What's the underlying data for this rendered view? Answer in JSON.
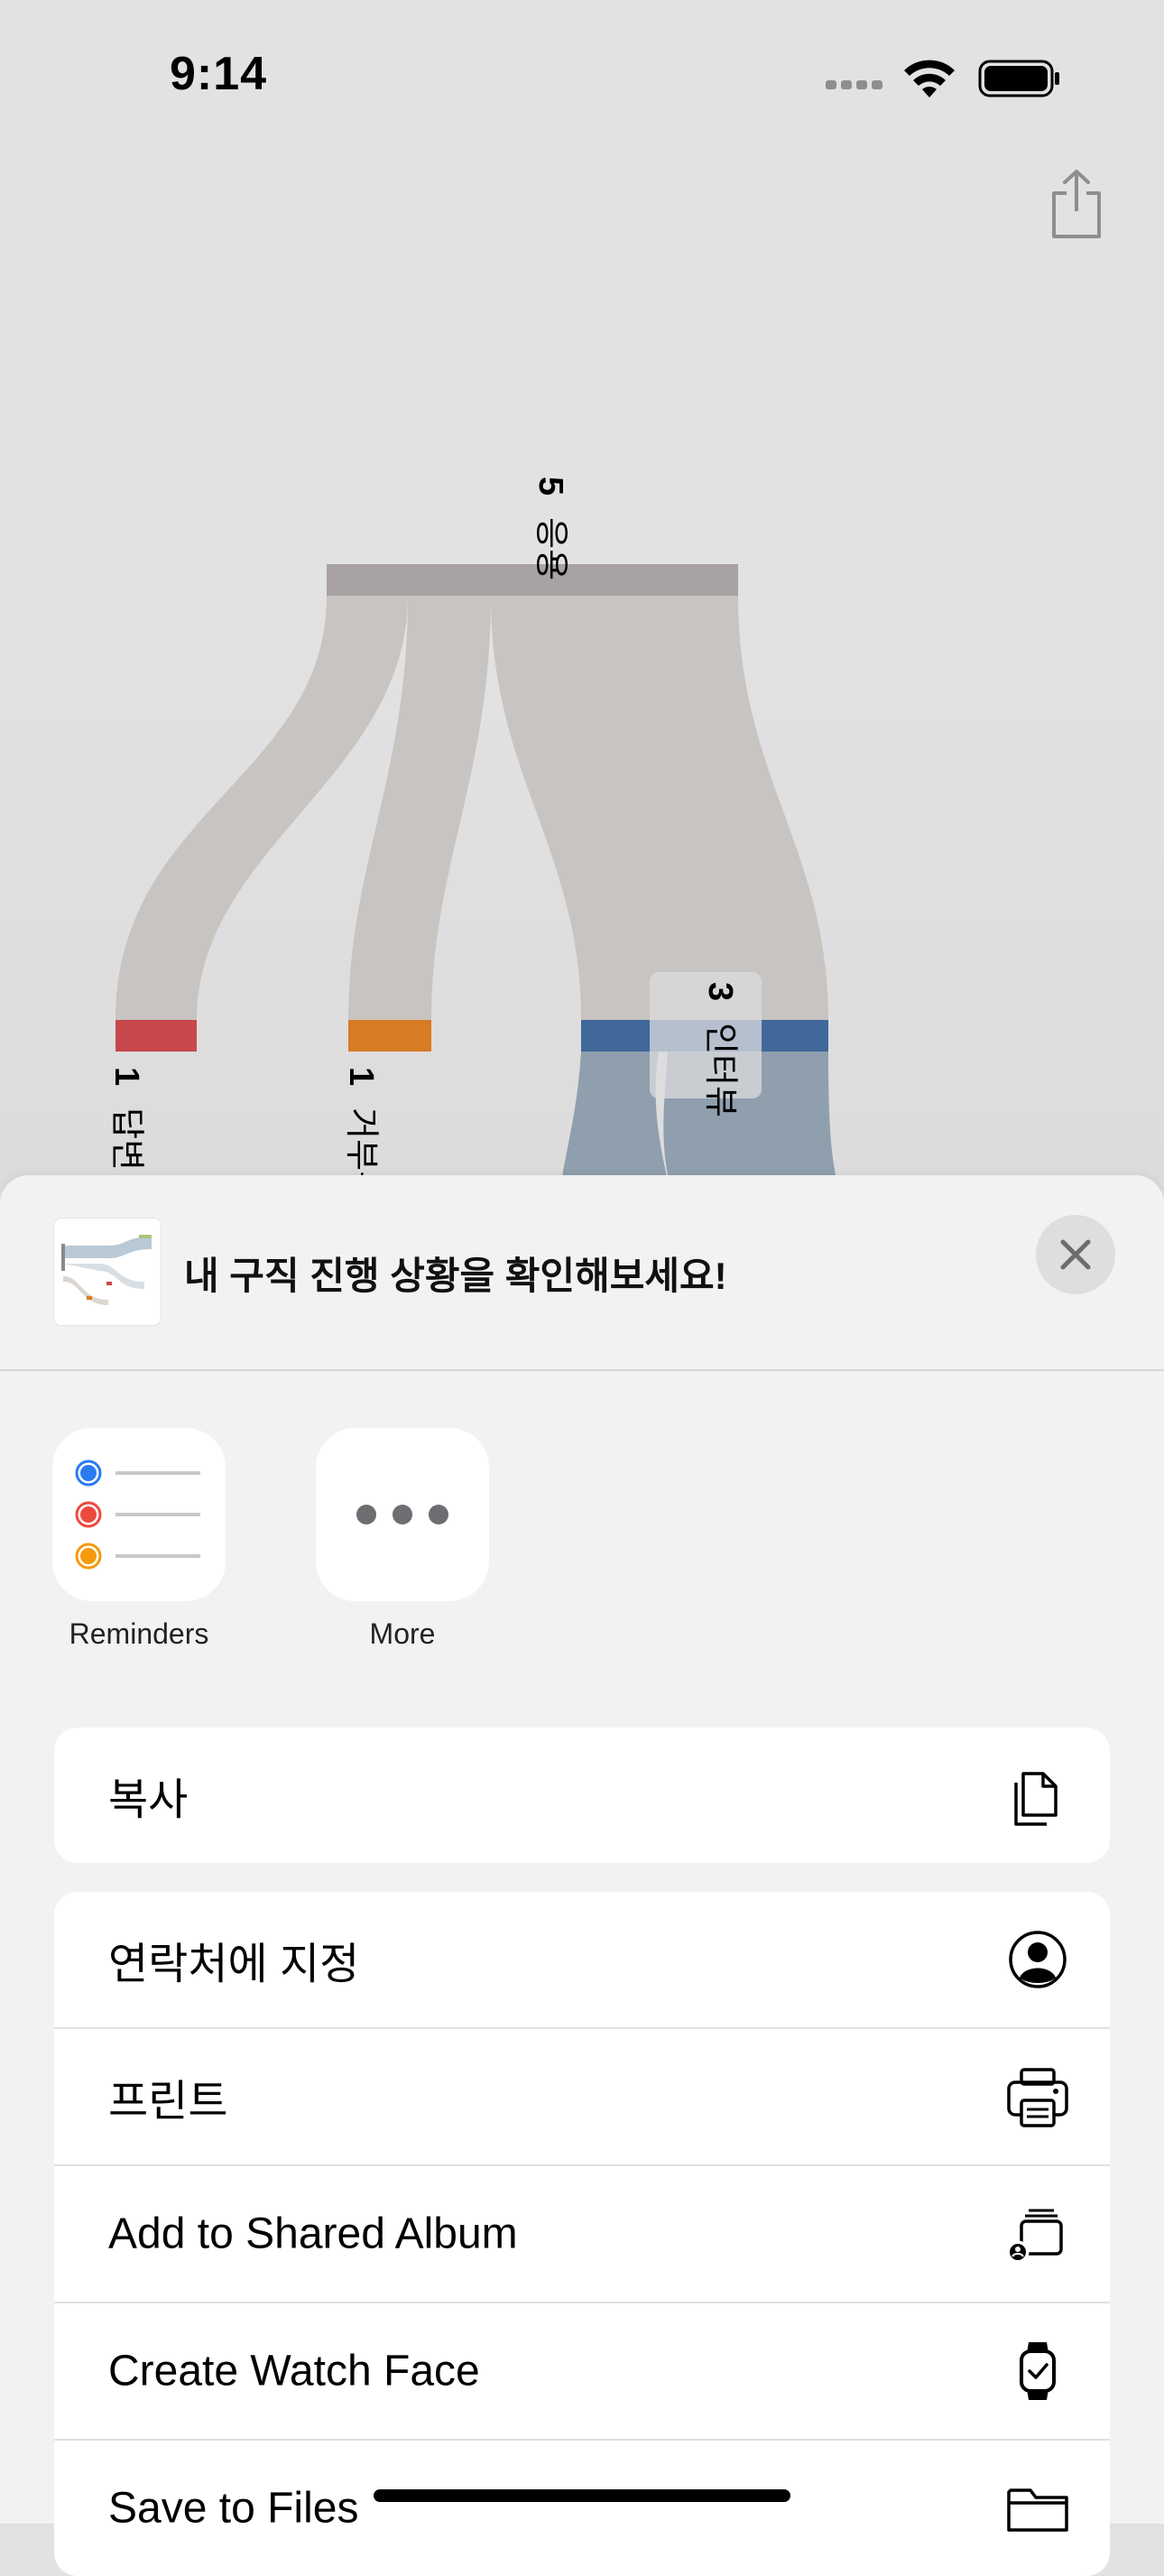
{
  "status_bar": {
    "time": "9:14",
    "icons": [
      "cellular-signal-icon",
      "wifi-icon",
      "battery-icon"
    ]
  },
  "toolbar": {
    "share_icon": "share-icon"
  },
  "sankey": {
    "source": {
      "label": "응용",
      "value": "5",
      "color": "#a8a2a2"
    },
    "targets": [
      {
        "label": "답변 없음",
        "value": "1",
        "color": "#c7484a"
      },
      {
        "label": "거부됨",
        "value": "1",
        "color": "#d77b25"
      },
      {
        "label": "인터뷰",
        "value": "3",
        "color": "#41689a"
      }
    ]
  },
  "share_sheet": {
    "title": "내 구직 진행 상황을 확인해보세요!",
    "close_icon": "close-icon",
    "apps": [
      {
        "label": "Reminders",
        "icon": "reminders-icon"
      },
      {
        "label": "More",
        "icon": "more-icon"
      }
    ],
    "actions_group1": [
      {
        "label": "복사",
        "icon": "copy-icon"
      }
    ],
    "actions_group2": [
      {
        "label": "연락처에 지정",
        "icon": "contact-icon"
      },
      {
        "label": "프린트",
        "icon": "printer-icon"
      },
      {
        "label": "Add to Shared Album",
        "icon": "shared-album-icon"
      },
      {
        "label": "Create Watch Face",
        "icon": "watch-icon"
      },
      {
        "label": "Save to Files",
        "icon": "folder-icon"
      }
    ]
  }
}
